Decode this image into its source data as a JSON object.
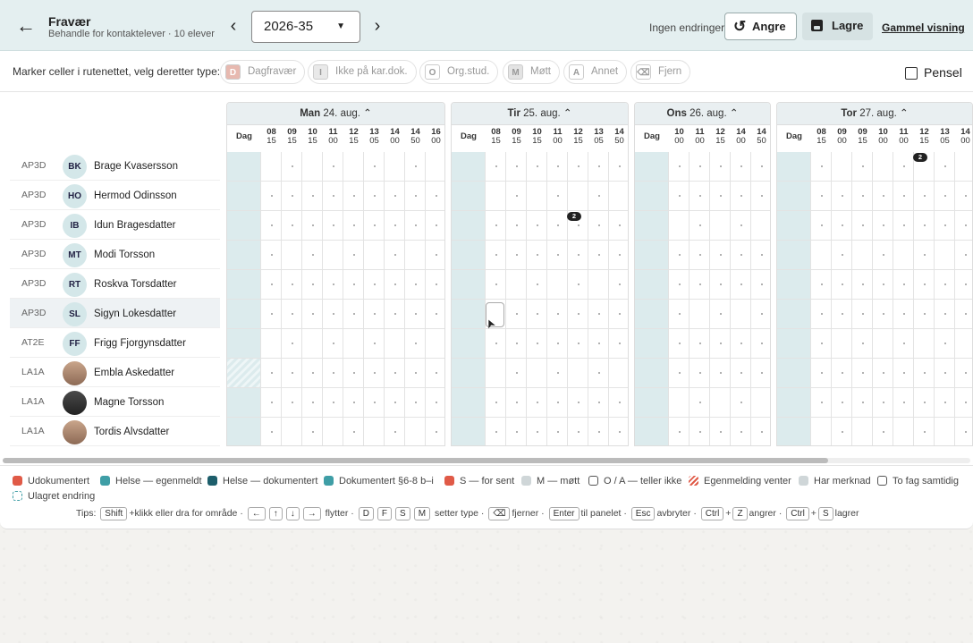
{
  "header": {
    "back_icon": "arrow-left-icon",
    "title": "Fravær",
    "subtitle": "Behandle for kontaktelever · 10 elever",
    "week": "2026-35",
    "status": "Ingen endringer",
    "undo": "Angre",
    "save": "Lagre",
    "old_view": "Gammel visning"
  },
  "toolbar": {
    "label": "Marker celler i rutenettet, velg deretter type:",
    "types": [
      {
        "key": "D",
        "label": "Dagfravær",
        "color": "#e7b9b0"
      },
      {
        "key": "I",
        "label": "Ikke på kar.dok.",
        "color": "#e9e9e9"
      },
      {
        "key": "O",
        "label": "Org.stud.",
        "color": "#ffffff"
      },
      {
        "key": "M",
        "label": "Møtt",
        "color": "#e3e3e3"
      },
      {
        "key": "A",
        "label": "Annet",
        "color": "#ffffff"
      },
      {
        "key": "⌫",
        "label": "Fjern",
        "color": "#ffffff"
      }
    ],
    "pensel": "Pensel"
  },
  "days": [
    {
      "name": "Man",
      "date": "24. aug.",
      "cols": [
        [
          "08",
          "15"
        ],
        [
          "09",
          "15"
        ],
        [
          "10",
          "15"
        ],
        [
          "11",
          "00"
        ],
        [
          "12",
          "15"
        ],
        [
          "13",
          "05"
        ],
        [
          "14",
          "00"
        ],
        [
          "14",
          "50"
        ],
        [
          "16",
          "00"
        ]
      ]
    },
    {
      "name": "Tir",
      "date": "25. aug.",
      "cols": [
        [
          "08",
          "15"
        ],
        [
          "09",
          "15"
        ],
        [
          "10",
          "15"
        ],
        [
          "11",
          "00"
        ],
        [
          "12",
          "15"
        ],
        [
          "13",
          "05"
        ],
        [
          "14",
          "50"
        ]
      ]
    },
    {
      "name": "Ons",
      "date": "26. aug.",
      "cols": [
        [
          "10",
          "00"
        ],
        [
          "11",
          "00"
        ],
        [
          "12",
          "15"
        ],
        [
          "14",
          "00"
        ],
        [
          "14",
          "50"
        ]
      ]
    },
    {
      "name": "Tor",
      "date": "27. aug.",
      "cols": [
        [
          "08",
          "15"
        ],
        [
          "09",
          "00"
        ],
        [
          "09",
          "15"
        ],
        [
          "10",
          "00"
        ],
        [
          "11",
          "00"
        ],
        [
          "12",
          "15"
        ],
        [
          "13",
          "05"
        ],
        [
          "14",
          "00"
        ]
      ]
    }
  ],
  "dag_label": "Dag",
  "students": [
    {
      "cls": "AP3D",
      "ini": "BK",
      "name": "Brage Kvasersson"
    },
    {
      "cls": "AP3D",
      "ini": "HO",
      "name": "Hermod Odinsson"
    },
    {
      "cls": "AP3D",
      "ini": "IB",
      "name": "Idun Bragesdatter"
    },
    {
      "cls": "AP3D",
      "ini": "MT",
      "name": "Modi Torsson"
    },
    {
      "cls": "AP3D",
      "ini": "RT",
      "name": "Roskva Torsdatter"
    },
    {
      "cls": "AP3D",
      "ini": "SL",
      "name": "Sigyn Lokesdatter"
    },
    {
      "cls": "AT2E",
      "ini": "FF",
      "name": "Frigg Fjorgynsdatter"
    },
    {
      "cls": "LA1A",
      "ini": "",
      "name": "Embla Askedatter"
    },
    {
      "cls": "LA1A",
      "ini": "",
      "name": "Magne Torsson"
    },
    {
      "cls": "LA1A",
      "ini": "",
      "name": "Tordis Alvsdatter"
    }
  ],
  "badges": [
    "2",
    "2"
  ],
  "legend": [
    {
      "label": "Udokumentert",
      "color": "#e05a47"
    },
    {
      "label": "Helse — egenmeldt",
      "color": "#3f9ea6"
    },
    {
      "label": "Helse — dokumentert",
      "color": "#1d5e6b"
    },
    {
      "label": "Dokumentert §6-8 b–i",
      "color": "#3f9ea6"
    },
    {
      "label": "S — for sent",
      "color": "#e05a47"
    },
    {
      "label": "M — møtt",
      "color": "#cfd6d8"
    },
    {
      "label": "O / A — teller ikke",
      "color": "#ffffff"
    },
    {
      "label": "Egenmelding venter",
      "color": "hatch"
    },
    {
      "label": "Har merknad",
      "color": "#cfd6d8"
    },
    {
      "label": "To fag samtidig",
      "color": "#ffffff"
    },
    {
      "label": "Ulagret endring",
      "color": "dashed"
    }
  ],
  "tips": {
    "label": "Tips:",
    "shift": "Shift",
    "t1": "+klikk eller dra for område ·",
    "left": "←",
    "up": "↑",
    "down": "↓",
    "right": "→",
    "t2": "flytter ·",
    "d": "D",
    "f": "F",
    "s": "S",
    "m": "M",
    "t3": "setter type ·",
    "bs": "⌫",
    "t4": "fjerner ·",
    "enter": "Enter",
    "t5": "til panelet ·",
    "esc": "Esc",
    "t6": "avbryter ·",
    "ctrl": "Ctrl",
    "plus": "+",
    "z": "Z",
    "t7": "angrer ·",
    "t8": "lagrer"
  }
}
